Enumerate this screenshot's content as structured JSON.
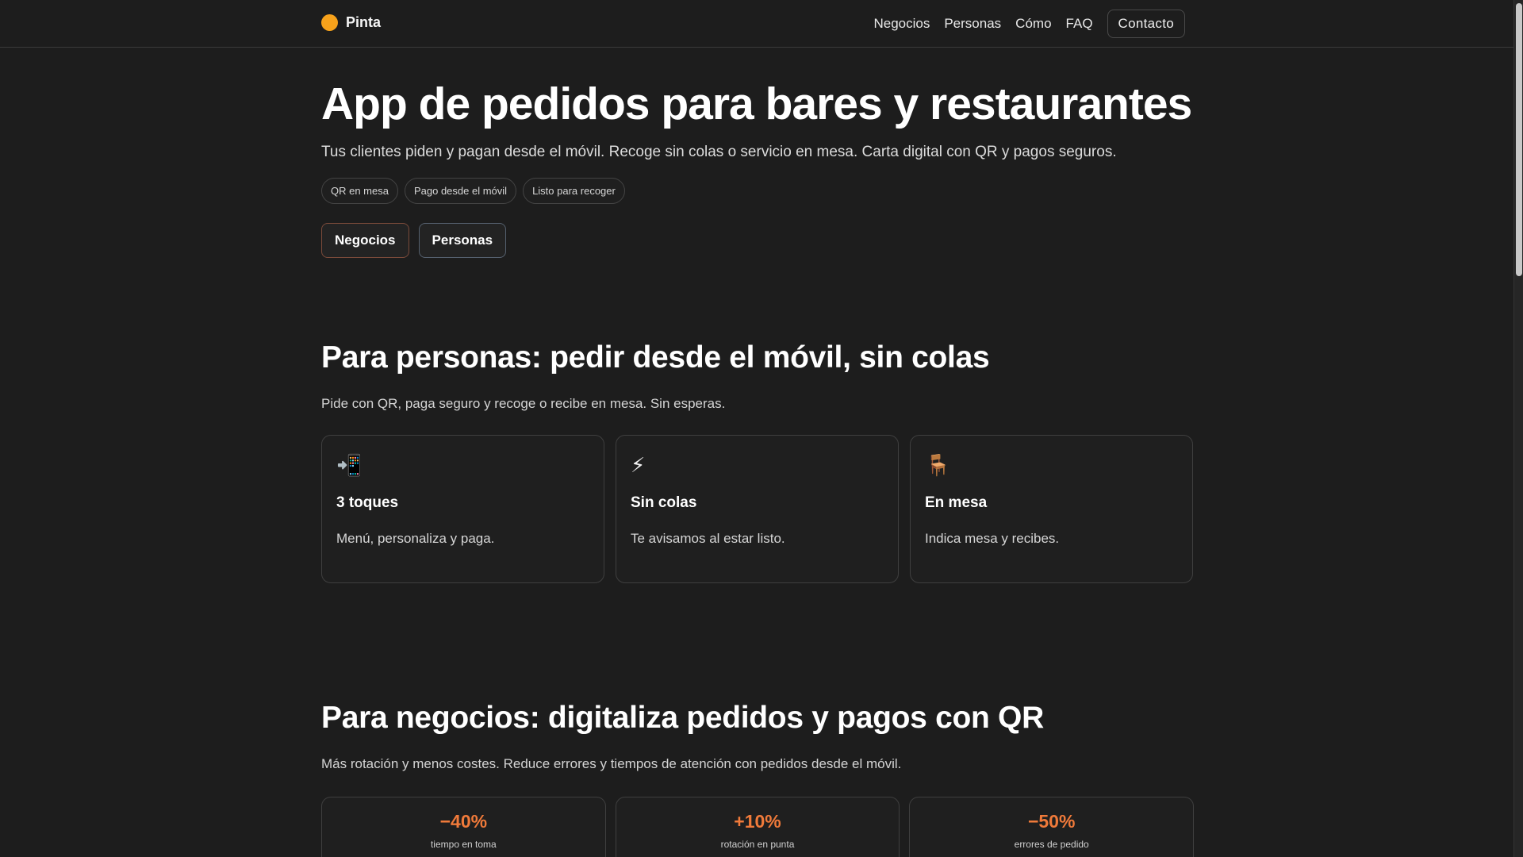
{
  "header": {
    "brand": "Pinta",
    "nav": [
      "Negocios",
      "Personas",
      "Cómo",
      "FAQ"
    ],
    "contact_label": "Contacto"
  },
  "hero": {
    "title": "App de pedidos para bares y restaurantes",
    "subtitle": "Tus clientes piden y pagan desde el móvil. Recoge sin colas o servicio en mesa. Carta digital con QR y pagos seguros.",
    "pills": [
      "QR en mesa",
      "Pago desde el móvil",
      "Listo para recoger"
    ],
    "cta_business": "Negocios",
    "cta_people": "Personas"
  },
  "personas": {
    "title": "Para personas: pedir desde el móvil, sin colas",
    "subtitle": "Pide con QR, paga seguro y recoge o recibe en mesa. Sin esperas.",
    "cards": [
      {
        "icon": "📲",
        "icon_name": "phone-arrow-icon",
        "title": "3 toques",
        "desc": "Menú, personaliza y paga."
      },
      {
        "icon": "⚡",
        "icon_name": "lightning-icon",
        "title": "Sin colas",
        "desc": "Te avisamos al estar listo."
      },
      {
        "icon": "🪑",
        "icon_name": "chair-icon",
        "title": "En mesa",
        "desc": "Indica mesa y recibes."
      }
    ]
  },
  "negocios": {
    "title": "Para negocios: digitaliza pedidos y pagos con QR",
    "subtitle": "Más rotación y menos costes. Reduce errores y tiempos de atención con pedidos desde el móvil.",
    "stats": [
      {
        "value": "−40%",
        "label": "tiempo en toma"
      },
      {
        "value": "+10%",
        "label": "rotación en punta"
      },
      {
        "value": "−50%",
        "label": "errores de pedido"
      }
    ]
  },
  "colors": {
    "background": "#1d1d1d",
    "brand_dot": "#f7a21b",
    "stat_accent": "#f07a3a"
  }
}
